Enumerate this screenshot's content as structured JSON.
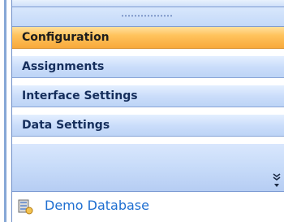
{
  "nav_pane": {
    "items": [
      {
        "label": "Configuration",
        "selected": true
      },
      {
        "label": "Assignments",
        "selected": false
      },
      {
        "label": "Interface Settings",
        "selected": false
      },
      {
        "label": "Data Settings",
        "selected": false
      }
    ],
    "overflow_icon": "double-chevron-down-icon"
  },
  "footer": {
    "icon": "database-icon",
    "label": "Demo Database"
  },
  "colors": {
    "selected_bg": "#f8a93a",
    "item_bg": "#c9dcfa",
    "item_text": "#152e5c",
    "border": "#7d9bd3",
    "footer_link": "#1f6fd1"
  }
}
